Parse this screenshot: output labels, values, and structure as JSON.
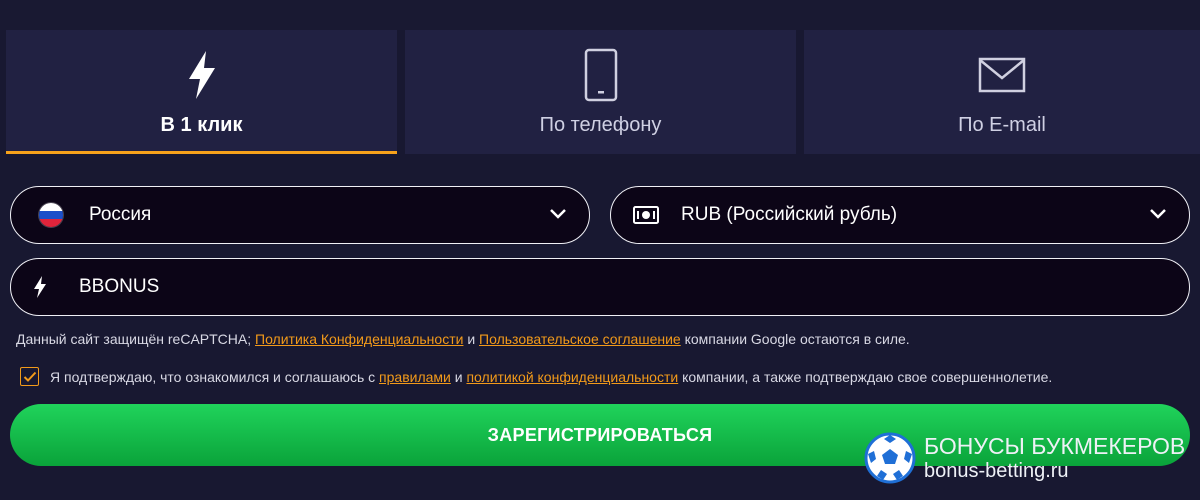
{
  "tabs": [
    {
      "label": "В 1 клик",
      "icon": "lightning-icon",
      "active": true
    },
    {
      "label": "По телефону",
      "icon": "phone-icon",
      "active": false
    },
    {
      "label": "По E-mail",
      "icon": "envelope-icon",
      "active": false
    }
  ],
  "form": {
    "country": {
      "value": "Россия",
      "icon": "russia-flag-icon"
    },
    "currency": {
      "value": "RUB (Российский рубль)",
      "icon": "banknote-icon"
    },
    "promo": {
      "value": "BBONUS",
      "icon": "lightning-icon"
    }
  },
  "recaptcha": {
    "prefix": "Данный сайт защищён reCAPTCHA;",
    "privacy_link": "Политика Конфиденциальности",
    "and": "и",
    "terms_link": "Пользовательское соглашение",
    "suffix": "компании Google остаются в силе."
  },
  "agreement": {
    "checked": true,
    "prefix": "Я подтверждаю, что ознакомился и соглашаюсь с",
    "rules_link": "правилами",
    "and": "и",
    "policy_link": "политикой конфиденциальности",
    "suffix": "компании, а также подтверждаю свое совершеннолетие."
  },
  "register_label": "ЗАРЕГИСТРИРОВАТЬСЯ",
  "watermark": {
    "title": "БОНУСЫ БУКМЕКЕРОВ",
    "url": "bonus-betting.ru"
  },
  "colors": {
    "background": "#181831",
    "tab": "#212142",
    "accent": "#f7a21b",
    "link": "#f29a1a",
    "button": "#0fb845"
  }
}
